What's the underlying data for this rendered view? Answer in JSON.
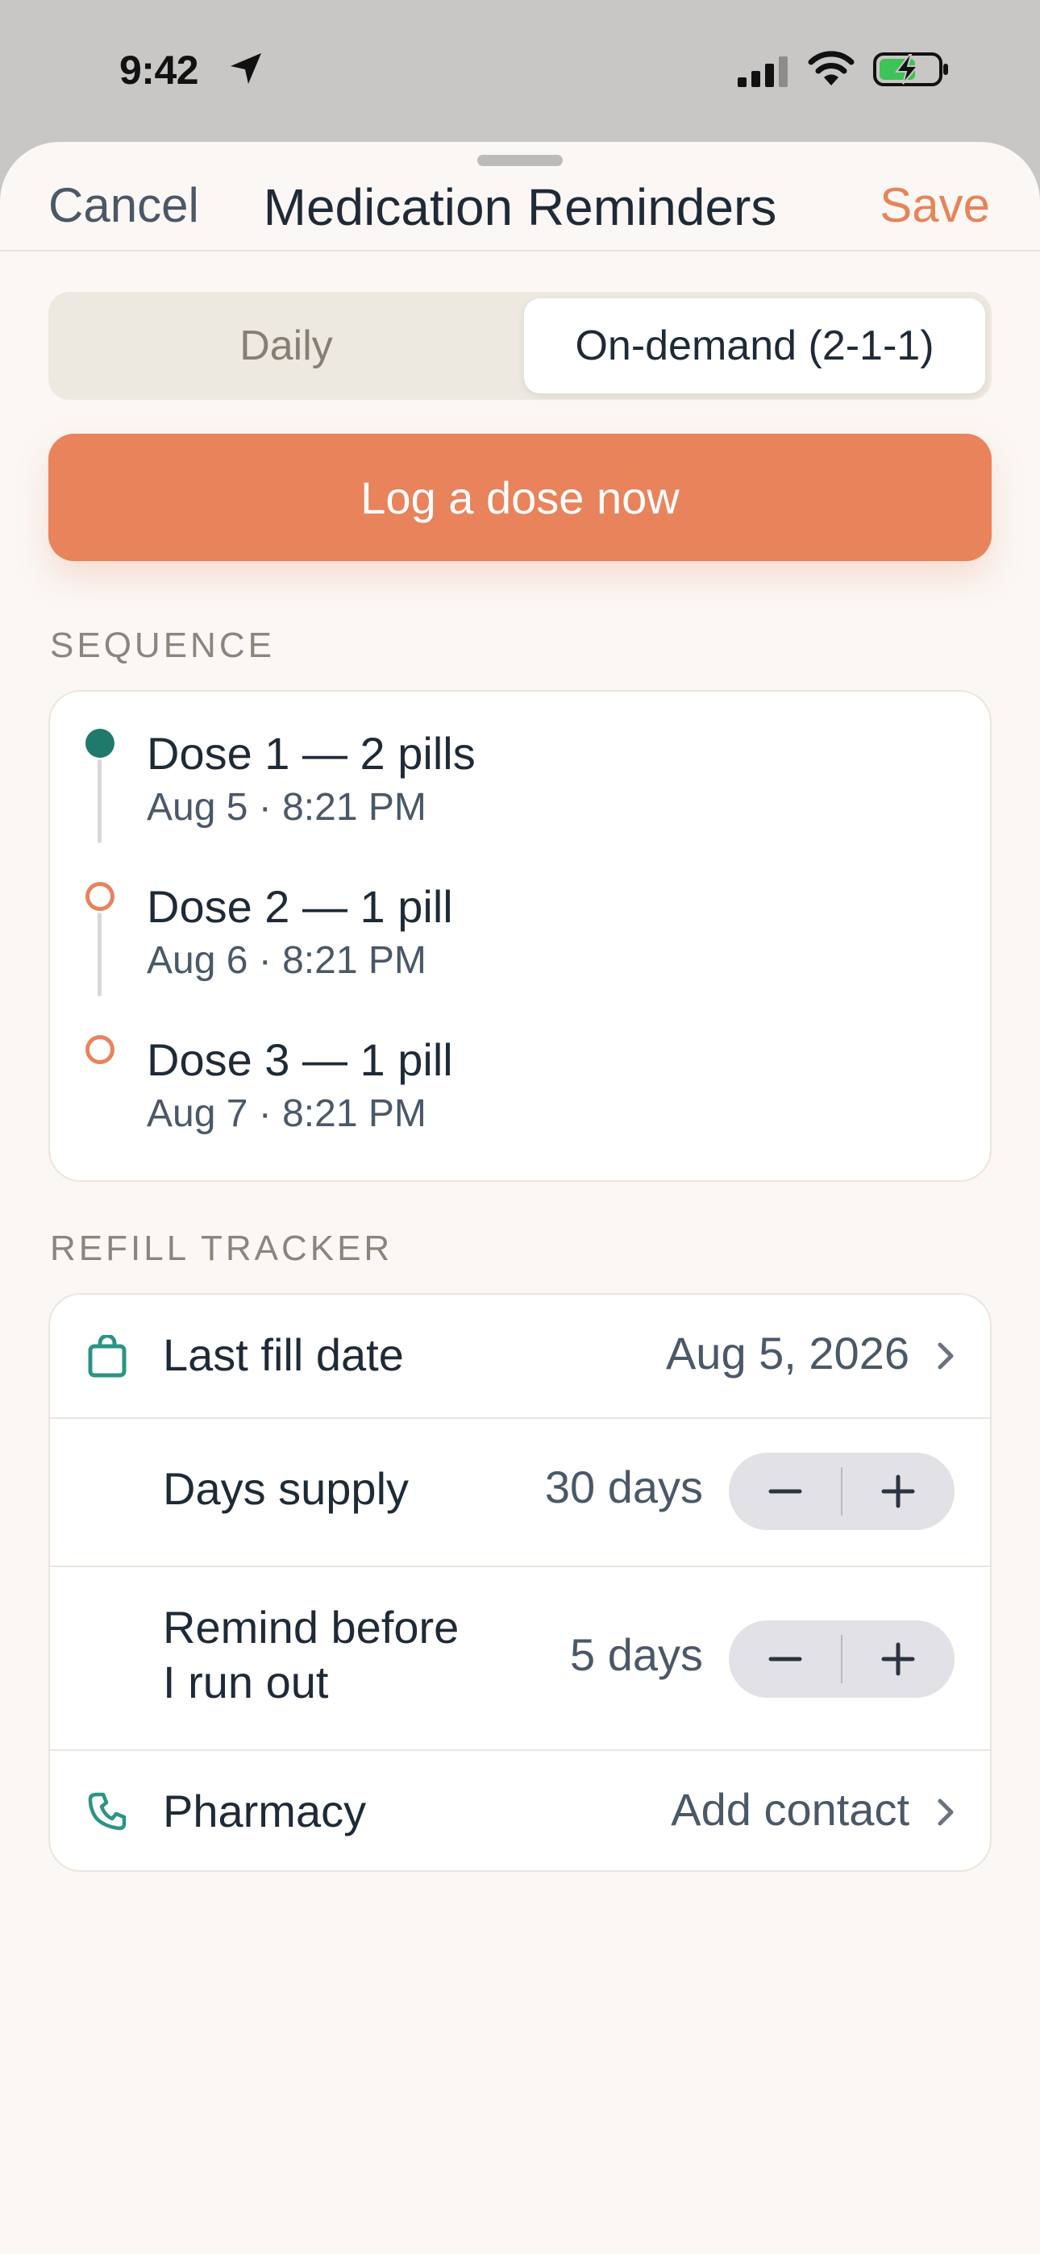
{
  "status_bar": {
    "time": "9:42",
    "icons": [
      "location-arrow-icon",
      "cellular-signal-icon",
      "wifi-icon",
      "battery-charging-icon"
    ]
  },
  "nav": {
    "cancel_label": "Cancel",
    "title": "Medication Reminders",
    "save_label": "Save"
  },
  "segmented": {
    "options": [
      "Daily",
      "On-demand (2-1-1)"
    ],
    "selected": "On-demand (2-1-1)"
  },
  "log_button_label": "Log a dose now",
  "sequence": {
    "section_label": "SEQUENCE",
    "doses": [
      {
        "title": "Dose 1 — 2 pills",
        "time": "Aug 5 · 8:21 PM",
        "status": "taken"
      },
      {
        "title": "Dose 2 — 1 pill",
        "time": "Aug 6 · 8:21 PM",
        "status": "upcoming"
      },
      {
        "title": "Dose 3 — 1 pill",
        "time": "Aug 7 · 8:21 PM",
        "status": "upcoming"
      }
    ]
  },
  "refill": {
    "section_label": "REFILL TRACKER",
    "last_fill": {
      "label": "Last fill date",
      "value": "Aug 5, 2026",
      "icon": "shopping-bag-icon"
    },
    "days_supply": {
      "label": "Days supply",
      "value": "30 days",
      "decrement": "−",
      "increment": "+"
    },
    "remind_before": {
      "label_line1": "Remind before",
      "label_line2": "I run out",
      "value": "5 days",
      "decrement": "−",
      "increment": "+"
    },
    "pharmacy": {
      "label": "Pharmacy",
      "value": "Add contact",
      "icon": "phone-icon"
    }
  },
  "colors": {
    "accent": "#e8835c",
    "teal": "#1f7a6b",
    "background": "#fbf7f4",
    "text": "#1f2a37"
  }
}
